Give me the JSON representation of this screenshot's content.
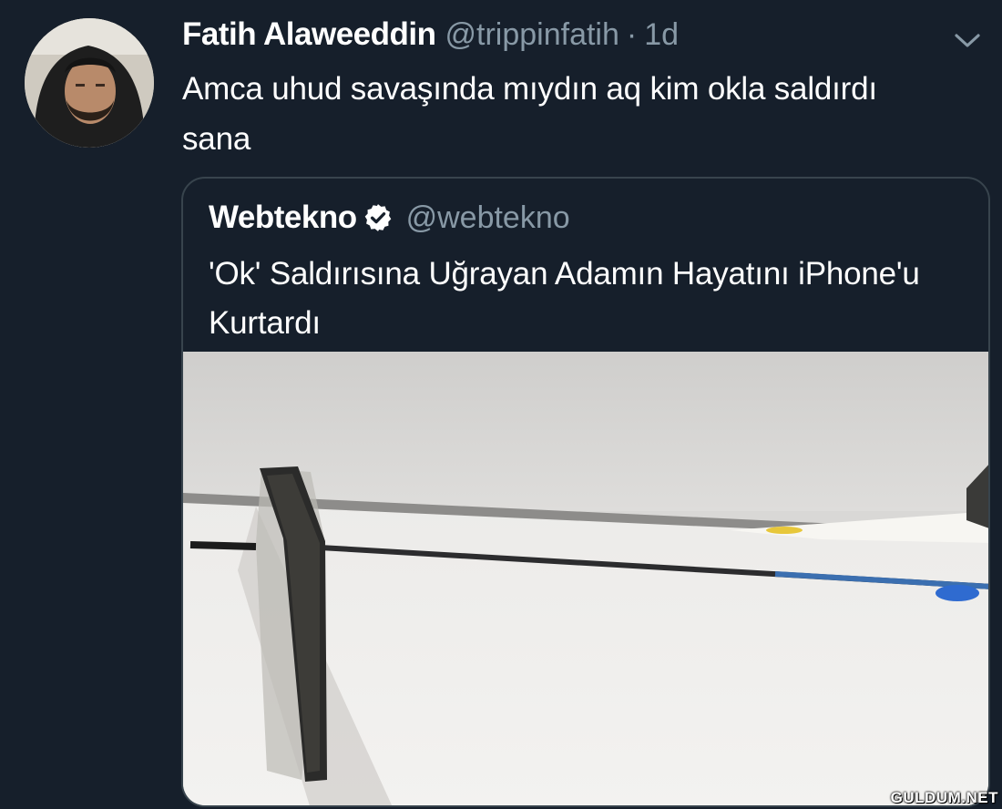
{
  "tweet": {
    "author_name": "Fatih Alaweeddin",
    "author_handle": "@trippinfatih",
    "separator": "·",
    "time": "1d",
    "text": "Amca uhud savaşında mıydın aq kim okla saldırdı sana",
    "menu_icon": "chevron-down-icon"
  },
  "quoted_tweet": {
    "author_name": "Webtekno",
    "verified_icon": "verified-badge-icon",
    "author_handle": "@webtekno",
    "text": "'Ok' Saldırısına Uğrayan Adamın Hayatını iPhone'u Kurtardı"
  },
  "watermark": "GULDUM.NET",
  "colors": {
    "background": "#161f2b",
    "text_primary": "#ffffff",
    "text_secondary": "#8899a6",
    "card_border": "#38444d"
  }
}
